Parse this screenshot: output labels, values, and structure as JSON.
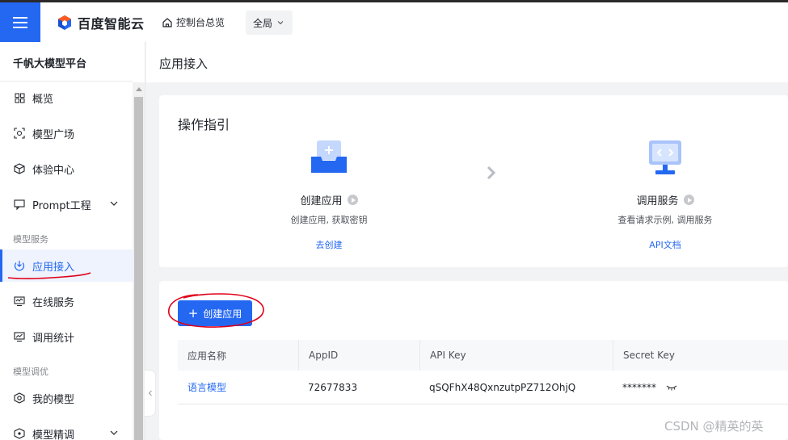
{
  "topbar": {
    "logo_text": "百度智能云",
    "console_label": "控制台总览",
    "scope_value": "全局"
  },
  "sidebar": {
    "title": "千帆大模型平台",
    "items": [
      {
        "label": "概览",
        "icon": "grid-icon"
      },
      {
        "label": "模型广场",
        "icon": "model-square-icon"
      },
      {
        "label": "体验中心",
        "icon": "cube-icon"
      },
      {
        "label": "Prompt工程",
        "icon": "prompt-icon",
        "expandable": true
      }
    ],
    "groups": [
      {
        "label": "模型服务",
        "items": [
          {
            "label": "应用接入",
            "icon": "download-circle-icon",
            "active": true
          },
          {
            "label": "在线服务",
            "icon": "monitor-wave-icon"
          },
          {
            "label": "调用统计",
            "icon": "chart-monitor-icon"
          }
        ]
      },
      {
        "label": "模型调优",
        "items": [
          {
            "label": "我的模型",
            "icon": "cube-target-icon"
          },
          {
            "label": "模型精调",
            "icon": "tune-icon",
            "expandable": true
          }
        ]
      }
    ]
  },
  "page": {
    "title": "应用接入"
  },
  "guide": {
    "title": "操作指引",
    "steps": [
      {
        "name": "创建应用",
        "desc": "创建应用, 获取密钥",
        "link": "去创建"
      },
      {
        "name": "调用服务",
        "desc": "查看请求示例, 调用服务",
        "link": "API文档"
      }
    ]
  },
  "apps": {
    "create_button": "创建应用",
    "columns": [
      "应用名称",
      "AppID",
      "API Key",
      "Secret Key"
    ],
    "rows": [
      {
        "name": "语言模型",
        "app_id": "72677833",
        "api_key": "qSQFhX48QxnzutpPZ712OhjQ",
        "secret_key": "*******"
      }
    ]
  },
  "watermark": "CSDN @精英的英",
  "colors": {
    "primary": "#2468f2",
    "annotation": "#e0001a"
  }
}
